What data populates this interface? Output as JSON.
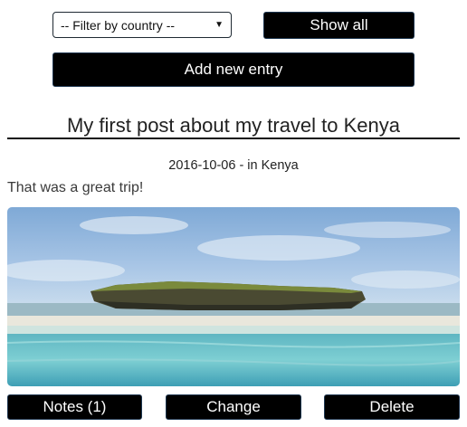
{
  "filter": {
    "selected": "-- Filter by country --",
    "caret_icon": "triangle-down-icon"
  },
  "controls": {
    "show_all_label": "Show all",
    "add_entry_label": "Add new entry"
  },
  "post": {
    "title": "My first post about my travel to Kenya",
    "meta": "2016-10-06 - in Kenya",
    "body": "That was a great trip!",
    "photo_subject": "island-beach-photo"
  },
  "actions": {
    "notes_label": "Notes (1)",
    "change_label": "Change",
    "delete_label": "Delete"
  },
  "colors": {
    "button_bg": "#000000",
    "button_text": "#ffffff",
    "button_border": "#1d3650",
    "rule": "#111111"
  }
}
